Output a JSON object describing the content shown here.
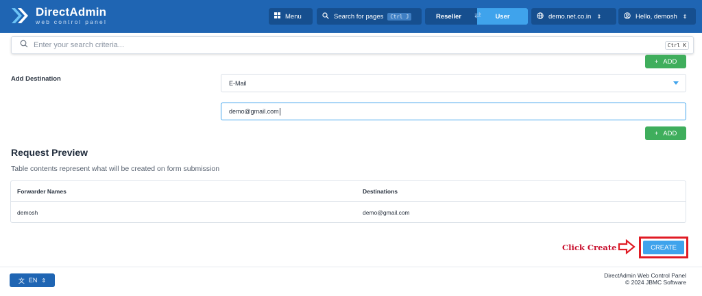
{
  "header": {
    "brand_title": "DirectAdmin",
    "brand_subtitle": "web control panel",
    "menu_label": "Menu",
    "search_pages_label": "Search for pages",
    "search_pages_shortcut": "Ctrl J",
    "role_reseller": "Reseller",
    "role_user": "User",
    "domain_label": "demo.net.co.in",
    "greeting": "Hello, demosh",
    "colors": {
      "bar": "#1f65b3",
      "button": "#164f8f",
      "accent": "#3fa3ec"
    }
  },
  "search": {
    "placeholder": "Enter your search criteria...",
    "shortcut": "Ctrl K"
  },
  "form": {
    "add_button_label": "ADD",
    "add_destination_label": "Add Destination",
    "destination_type_selected": "E-Mail",
    "destination_value": "demo@gmail.com"
  },
  "preview": {
    "title": "Request Preview",
    "description": "Table contents represent what will be created on form submission",
    "columns": [
      "Forwarder Names",
      "Destinations"
    ],
    "rows": [
      [
        "demosh",
        "demo@gmail.com"
      ]
    ]
  },
  "actions": {
    "create_label": "CREATE",
    "annotation": "Click Create"
  },
  "footer": {
    "language": "EN",
    "product": "DirectAdmin Web Control Panel",
    "copyright": "© 2024 JBMC Software"
  }
}
